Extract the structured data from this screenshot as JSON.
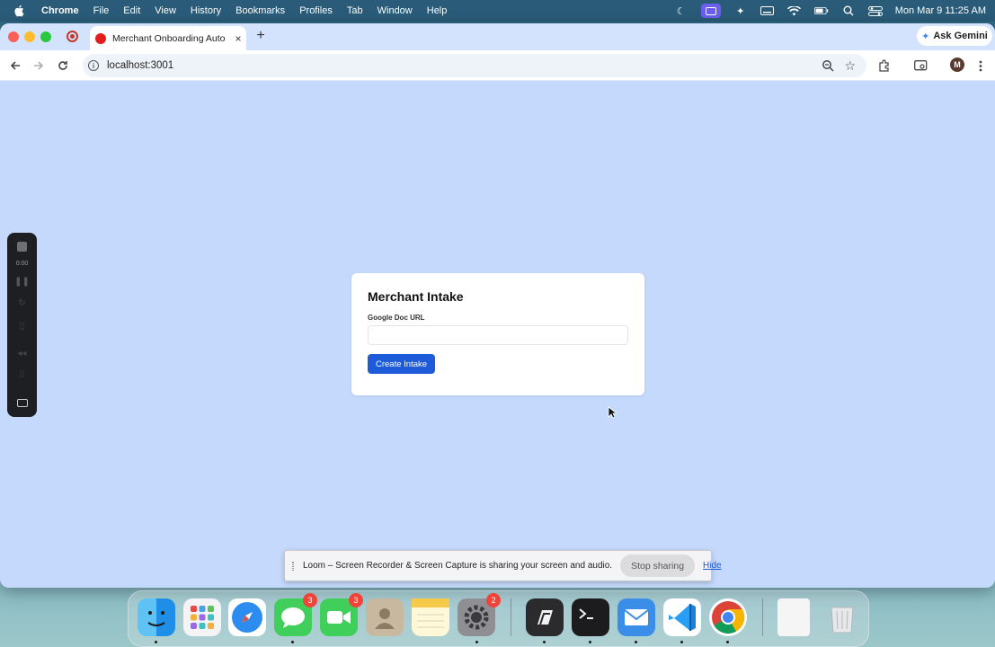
{
  "menubar": {
    "app_name": "Chrome",
    "items": [
      "File",
      "Edit",
      "View",
      "History",
      "Bookmarks",
      "Profiles",
      "Tab",
      "Window",
      "Help"
    ],
    "clock": "Mon Mar 9  11:25 AM"
  },
  "browser": {
    "tab_title": "Merchant Onboarding Autom",
    "tab_close": "×",
    "new_tab": "+",
    "ask_gemini": "Ask Gemini",
    "url": "localhost:3001",
    "profile_initial": "M"
  },
  "page": {
    "title": "Merchant Intake",
    "field_label": "Google Doc URL",
    "field_value": "",
    "submit_label": "Create Intake",
    "background": "#c4d9fb",
    "accent": "#1d5bd8"
  },
  "loom": {
    "timer": "0:00"
  },
  "share_bar": {
    "message": "Loom – Screen Recorder & Screen Capture is sharing your screen and audio.",
    "stop_label": "Stop sharing",
    "hide_label": "Hide"
  },
  "dock": {
    "messages_badge": "3",
    "facetime_badge": "3",
    "settings_badge": "2"
  }
}
